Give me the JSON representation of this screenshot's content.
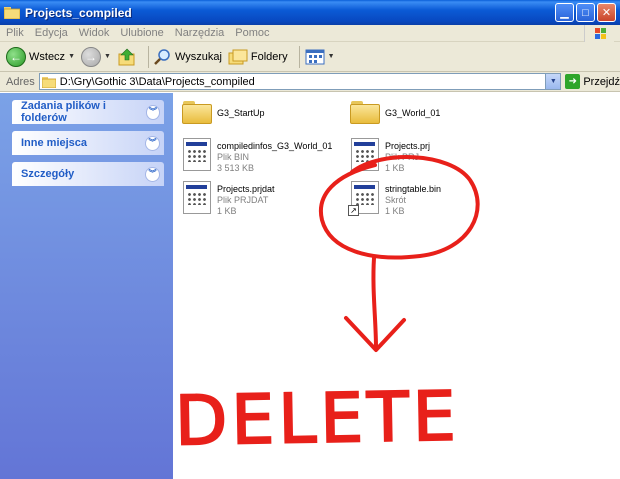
{
  "window": {
    "title": "Projects_compiled"
  },
  "menu": [
    "Plik",
    "Edycja",
    "Widok",
    "Ulubione",
    "Narzędzia",
    "Pomoc"
  ],
  "toolbar": {
    "back_label": "Wstecz",
    "search_label": "Wyszukaj",
    "folders_label": "Foldery"
  },
  "address": {
    "label": "Adres",
    "value": "D:\\Gry\\Gothic 3\\Data\\Projects_compiled",
    "go_label": "Przejdź"
  },
  "taskpane": {
    "panels": [
      {
        "label": "Zadania plików i folderów"
      },
      {
        "label": "Inne miejsca"
      },
      {
        "label": "Szczegóły"
      }
    ]
  },
  "files": [
    {
      "name": "G3_StartUp",
      "type": "",
      "size": "",
      "icon": "folder-icon"
    },
    {
      "name": "G3_World_01",
      "type": "",
      "size": "",
      "icon": "folder-icon"
    },
    {
      "name": "compiledinfos_G3_World_01",
      "type": "Plik BIN",
      "size": "3 513 KB",
      "icon": "file-icon"
    },
    {
      "name": "Projects.prj",
      "type": "Plik PRJ",
      "size": "1 KB",
      "icon": "file-icon"
    },
    {
      "name": "Projects.prjdat",
      "type": "Plik PRJDAT",
      "size": "1 KB",
      "icon": "file-icon"
    },
    {
      "name": "stringtable.bin",
      "type": "Skrót",
      "size": "1 KB",
      "icon": "shortcut-file-icon"
    }
  ],
  "annotation": {
    "text": "DELETE",
    "color": "#e8201a"
  },
  "colors": {
    "titlebar": "#0b5bd6",
    "taskpane": "#6f8fe0",
    "panel_text": "#215dc6"
  }
}
